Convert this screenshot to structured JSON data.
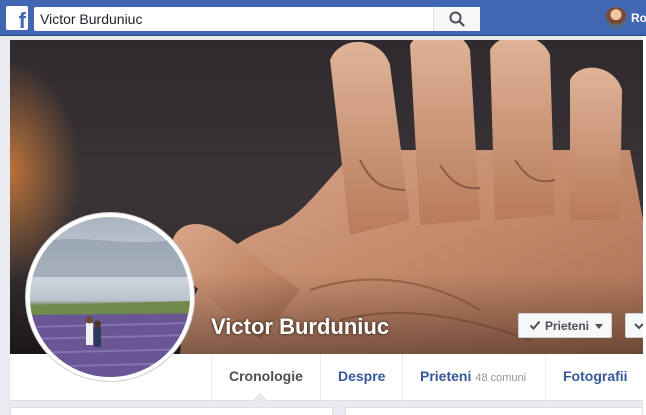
{
  "topbar": {
    "logo_letter": "f",
    "search_value": "Victor Burduniuc",
    "user_label": "Ro",
    "colors": {
      "bar": "#4267b2"
    }
  },
  "icons": {
    "logo": "facebook-logo",
    "search": "search-icon",
    "friends_check": "check-icon",
    "friends_caret": "caret-down-icon",
    "follow": "chevron-down-icon"
  },
  "profile": {
    "name": "Victor Burduniuc",
    "friends_button_label": "Prieteni"
  },
  "tabs": [
    {
      "label": "Cronologie",
      "active": true
    },
    {
      "label": "Despre"
    },
    {
      "label": "Prieteni",
      "count": "48 comuni"
    },
    {
      "label": "Fotografii"
    }
  ]
}
